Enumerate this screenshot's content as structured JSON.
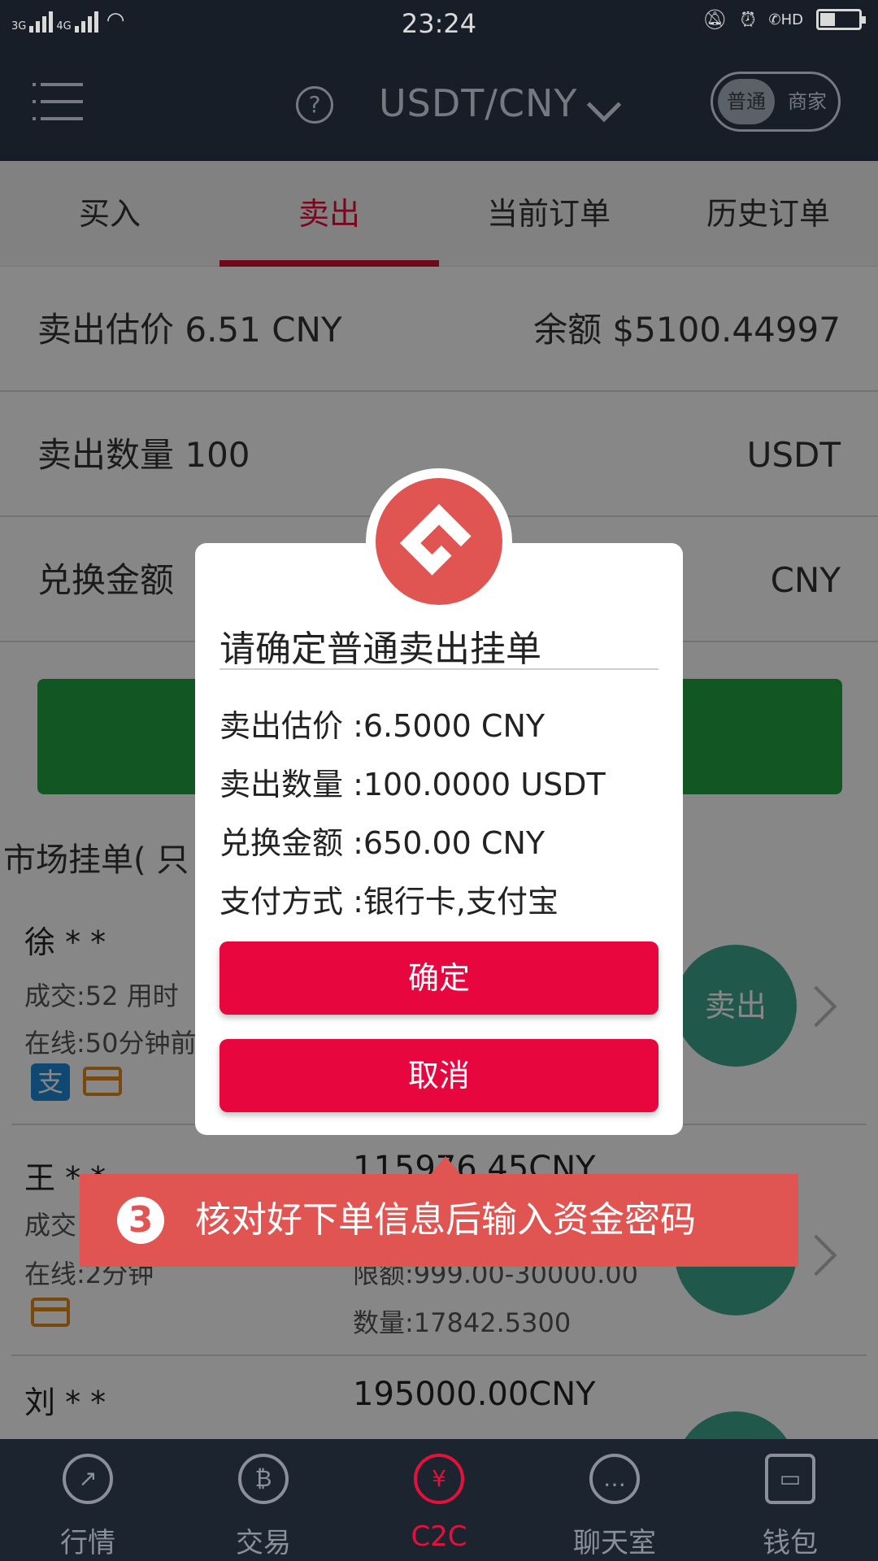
{
  "status_bar": {
    "signal_1": "3G",
    "signal_2": "4G",
    "time": "23:24",
    "hd": "HD"
  },
  "header": {
    "help": "?",
    "pair": "USDT/CNY",
    "mode_active": "普通",
    "mode_other": "商家"
  },
  "tabs": [
    "买入",
    "卖出",
    "当前订单",
    "历史订单"
  ],
  "form": {
    "price_label": "卖出估价 6.51  CNY",
    "balance": "余额 $5100.44997",
    "qty_label": "卖出数量 100",
    "qty_unit": "USDT",
    "amount_label": "兑换金额",
    "amount_unit": "CNY"
  },
  "market": {
    "title": "市场挂单( 只"
  },
  "orders": [
    {
      "name": "徐 * *",
      "deals": "成交:52  用时",
      "online": "在线:50分钟前",
      "button": "卖出"
    },
    {
      "name": "王 * *",
      "deals": "成交",
      "online": "在线:2分钟",
      "amount": "115976.45CNY",
      "limit": "限额:999.00-30000.00",
      "quantity": "数量:17842.5300"
    },
    {
      "name": "刘 * *",
      "amount": "195000.00CNY"
    }
  ],
  "dialog": {
    "title": "请确定普通卖出挂单",
    "price": "卖出估价 :6.5000 CNY",
    "quantity": "卖出数量 :100.0000 USDT",
    "amount": "兑换金额 :650.00 CNY",
    "payment": "支付方式 :银行卡,支付宝",
    "confirm": "确定",
    "cancel": "取消"
  },
  "banner": {
    "step": "3",
    "text": "核对好下单信息后输入资金密码"
  },
  "nav": [
    {
      "label": "行情",
      "icon": "trend-chart-icon"
    },
    {
      "label": "交易",
      "icon": "bitcoin-icon"
    },
    {
      "label": "C2C",
      "icon": "yuan-coin-icon"
    },
    {
      "label": "聊天室",
      "icon": "chat-bubble-icon"
    },
    {
      "label": "钱包",
      "icon": "wallet-icon"
    }
  ],
  "colors": {
    "brand_red": "#e8063f",
    "header_bg": "#1c2430",
    "accent_green": "#22a345",
    "banner_red": "#e05452"
  }
}
